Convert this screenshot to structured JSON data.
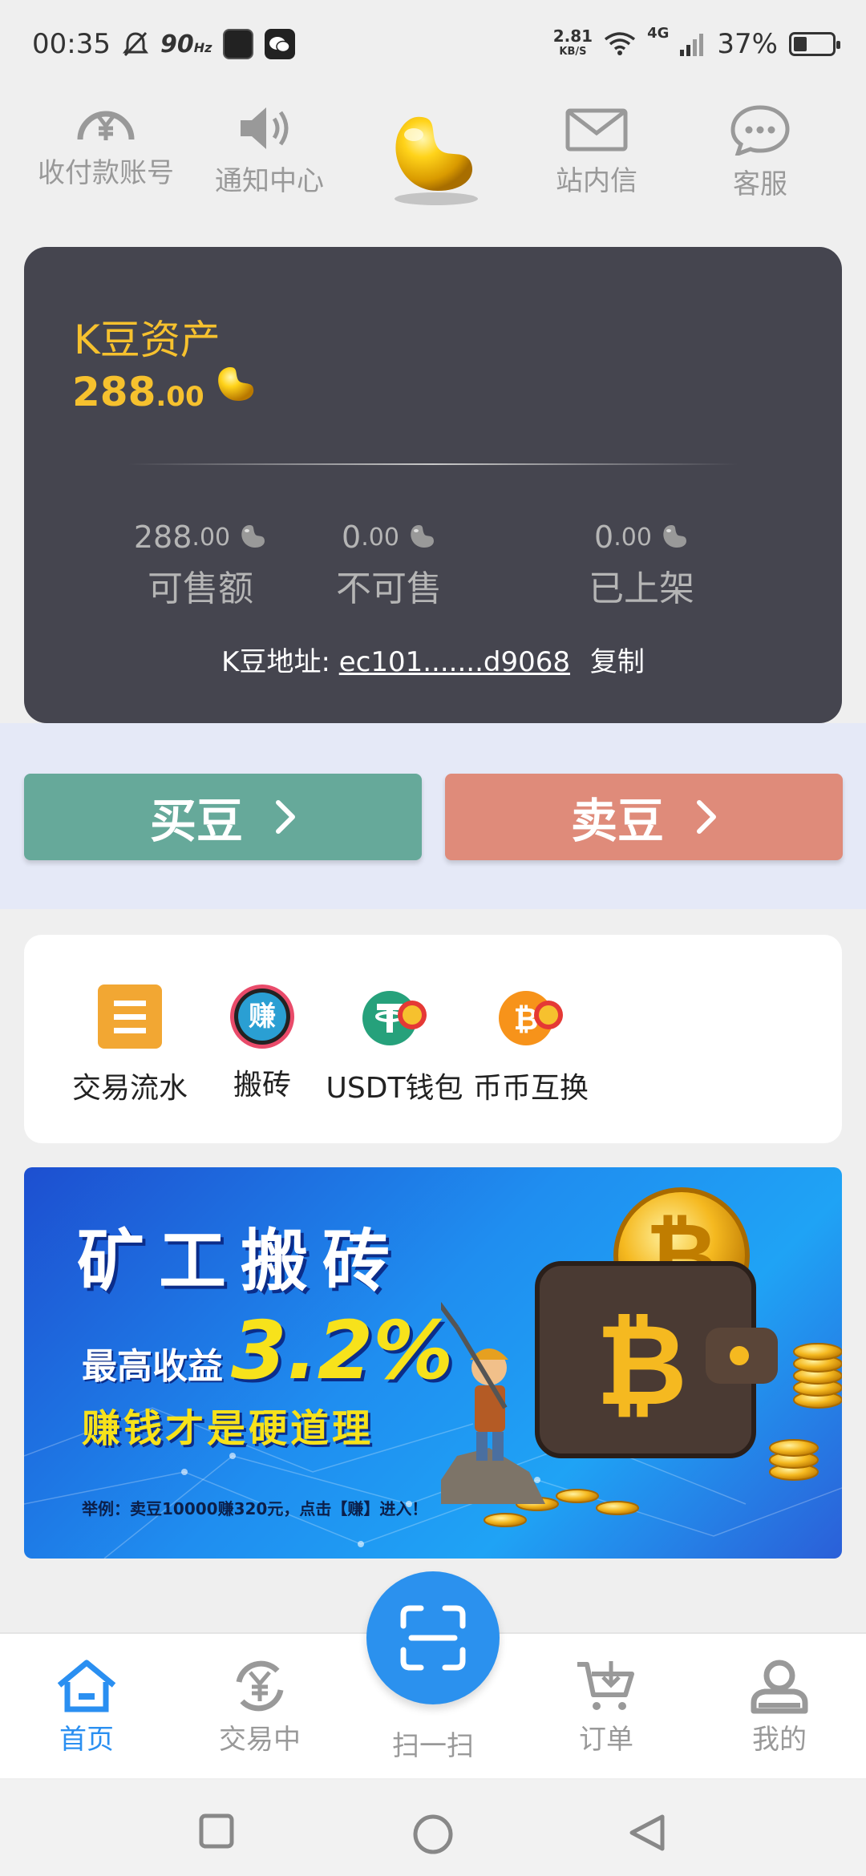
{
  "status_bar": {
    "time": "00:35",
    "refresh_rate": "90",
    "refresh_unit": "Hz",
    "net_speed": "2.81",
    "net_unit": "KB/S",
    "network": "4G",
    "battery": "37%"
  },
  "top_nav": [
    {
      "label": "收付款账号",
      "icon": "yen-circle-icon"
    },
    {
      "label": "通知中心",
      "icon": "speaker-icon"
    },
    {
      "label": "",
      "icon": "gold-bean-icon"
    },
    {
      "label": "站内信",
      "icon": "mail-icon"
    },
    {
      "label": "客服",
      "icon": "chat-bubble-icon"
    }
  ],
  "asset": {
    "title": "K豆资产",
    "value_int": "288",
    "value_dec": ".00",
    "stats": [
      {
        "int": "288",
        "dec": ".00",
        "label": "可售额"
      },
      {
        "int": "0",
        "dec": ".00",
        "label": "不可售"
      },
      {
        "int": "0",
        "dec": ".00",
        "label": "已上架"
      }
    ],
    "address_label": "K豆地址:",
    "address_value": "ec101.......d9068",
    "copy_label": "复制"
  },
  "actions": {
    "buy_label": "买豆",
    "sell_label": "卖豆",
    "buy_color": "#66a99a",
    "sell_color": "#df8b7a"
  },
  "features": [
    {
      "label": "交易流水",
      "icon": "transaction-list-icon"
    },
    {
      "label": "搬砖",
      "icon": "earn-badge-icon",
      "badge_text": "赚"
    },
    {
      "label": "USDT钱包",
      "icon": "usdt-wallet-icon"
    },
    {
      "label": "币币互换",
      "icon": "bitcoin-swap-icon"
    }
  ],
  "banner": {
    "title": "矿工搬砖",
    "subtitle": "最高收益",
    "percent": "3.2%",
    "slogan": "赚钱才是硬道理",
    "note": "举例：卖豆10000赚320元，点击【赚】进入！"
  },
  "tab_bar": [
    {
      "label": "首页",
      "icon": "home-icon",
      "active": true
    },
    {
      "label": "交易中",
      "icon": "yen-exchange-icon",
      "active": false
    },
    {
      "label": "扫一扫",
      "icon": "scan-icon",
      "active": false
    },
    {
      "label": "订单",
      "icon": "cart-icon",
      "active": false
    },
    {
      "label": "我的",
      "icon": "user-icon",
      "active": false
    }
  ],
  "colors": {
    "accent": "#2a8ff1",
    "card_bg": "#45454f",
    "gold": "#f6c12e"
  }
}
